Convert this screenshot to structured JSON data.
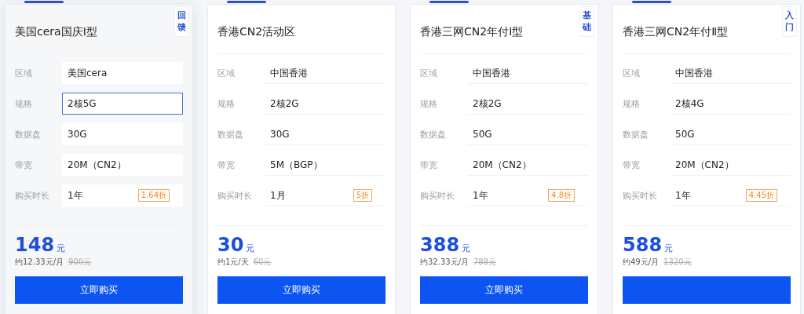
{
  "plans": [
    {
      "title": "美国cera国庆Ⅰ型",
      "selected": true,
      "side_tab": "回馈",
      "specs": [
        {
          "label": "区域",
          "value": "美国cera",
          "focused": false
        },
        {
          "label": "规格",
          "value": "2核5G",
          "focused": true
        },
        {
          "label": "数据盘",
          "value": "30G",
          "focused": false
        },
        {
          "label": "带宽",
          "value": "20M（CN2）",
          "focused": false
        },
        {
          "label": "购买时长",
          "value": "1年",
          "focused": false
        }
      ],
      "discount": "1.64折",
      "price": "148",
      "unit": "元",
      "per": "约12.33元/月",
      "original": "900元",
      "button": "立即购买"
    },
    {
      "title": "香港CN2活动区",
      "selected": false,
      "specs": [
        {
          "label": "区域",
          "value": "中国香港",
          "focused": false
        },
        {
          "label": "规格",
          "value": "2核2G",
          "focused": false
        },
        {
          "label": "数据盘",
          "value": "30G",
          "focused": false
        },
        {
          "label": "带宽",
          "value": "5M（BGP）",
          "focused": false
        },
        {
          "label": "购买时长",
          "value": "1月",
          "focused": false
        }
      ],
      "discount": "5折",
      "price": "30",
      "unit": "元",
      "per": "约1元/天",
      "original": "60元",
      "button": "立即购买"
    },
    {
      "title": "香港三网CN2年付Ⅰ型",
      "selected": false,
      "side_tab": "基础",
      "specs": [
        {
          "label": "区域",
          "value": "中国香港",
          "focused": false
        },
        {
          "label": "规格",
          "value": "2核2G",
          "focused": false
        },
        {
          "label": "数据盘",
          "value": "50G",
          "focused": false
        },
        {
          "label": "带宽",
          "value": "20M（CN2）",
          "focused": false
        },
        {
          "label": "购买时长",
          "value": "1年",
          "focused": false
        }
      ],
      "discount": "4.8折",
      "price": "388",
      "unit": "元",
      "per": "约32.33元/月",
      "original": "788元",
      "button": "立即购买"
    },
    {
      "title": "香港三网CN2年付Ⅱ型",
      "selected": false,
      "side_tab": "入门",
      "specs": [
        {
          "label": "区域",
          "value": "中国香港",
          "focused": false
        },
        {
          "label": "规格",
          "value": "2核4G",
          "focused": false
        },
        {
          "label": "数据盘",
          "value": "50G",
          "focused": false
        },
        {
          "label": "带宽",
          "value": "20M（CN2）",
          "focused": false
        },
        {
          "label": "购买时长",
          "value": "1年",
          "focused": false
        }
      ],
      "discount": "4.45折",
      "price": "588",
      "unit": "元",
      "per": "约49元/月",
      "original": "1320元"
    }
  ]
}
